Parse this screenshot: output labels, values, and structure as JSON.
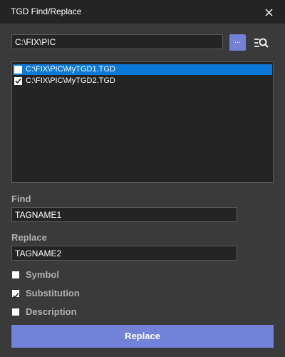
{
  "window": {
    "title": "TGD Find/Replace",
    "close_icon": "close-icon"
  },
  "folder": {
    "path": "C:\\FIX\\PIC",
    "browse_label": "...",
    "search_icon": "search-list-icon"
  },
  "files": [
    {
      "label": "C:\\FIX\\PIC\\MyTGD1.TGD",
      "checked": false,
      "selected": true
    },
    {
      "label": "C:\\FIX\\PIC\\MyTGD2.TGD",
      "checked": true,
      "selected": false
    }
  ],
  "find": {
    "label": "Find",
    "value": "TAGNAME1"
  },
  "replace": {
    "label": "Replace",
    "value": "TAGNAME2"
  },
  "options": [
    {
      "label": "Symbol",
      "checked": false
    },
    {
      "label": "Substitution",
      "checked": true
    },
    {
      "label": "Description",
      "checked": false
    }
  ],
  "action": {
    "label": "Replace"
  },
  "colors": {
    "accent": "#7282d8",
    "selection": "#0b79d8",
    "background": "#3a3a3a",
    "titlebar": "#242424"
  }
}
